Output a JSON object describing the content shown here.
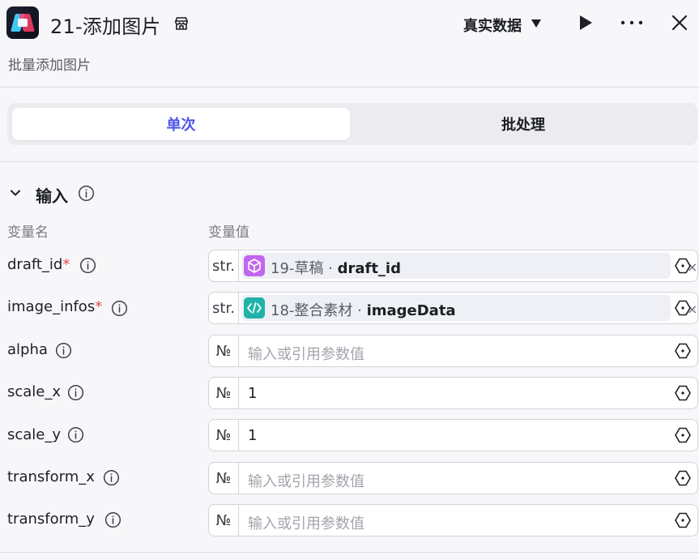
{
  "header": {
    "title": "21-添加图片",
    "subtitle": "批量添加图片",
    "mode_label": "真实数据"
  },
  "tabs": {
    "single": "单次",
    "batch": "批处理"
  },
  "input_section": {
    "title": "输入",
    "col_name": "变量名",
    "col_value": "变量值"
  },
  "rows": [
    {
      "name": "draft_id",
      "required": "*",
      "type": "str.",
      "ref_node": "19-草稿 · ",
      "ref_field": "draft_id",
      "ref_color": "#c065f0"
    },
    {
      "name": "image_infos",
      "required": "*",
      "type": "str.",
      "ref_node": "18-整合素材 · ",
      "ref_field": "imageData",
      "ref_color": "#1fb3a8"
    },
    {
      "name": "alpha",
      "type": "№",
      "placeholder": "输入或引用参数值"
    },
    {
      "name": "scale_x",
      "type": "№",
      "value": "1"
    },
    {
      "name": "scale_y",
      "type": "№",
      "value": "1"
    },
    {
      "name": "transform_x",
      "type": "№",
      "placeholder": "输入或引用参数值"
    },
    {
      "name": "transform_y",
      "type": "№",
      "placeholder": "输入或引用参数值"
    }
  ],
  "icons": {
    "clear": "×"
  },
  "colors": {
    "accent": "#4d53e8",
    "required": "#e5484d"
  }
}
